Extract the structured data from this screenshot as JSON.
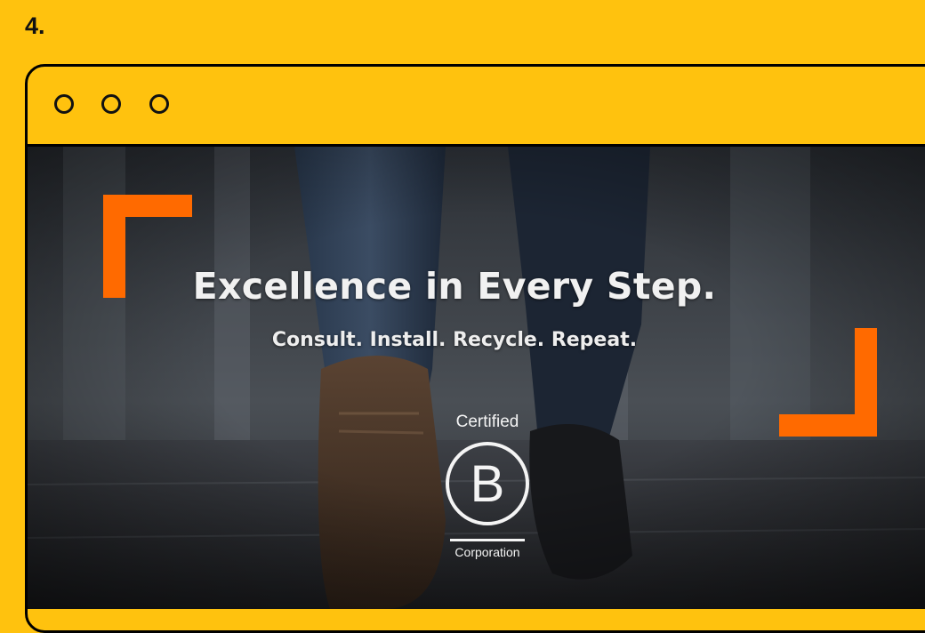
{
  "step": {
    "number": "4."
  },
  "window": {
    "controls": [
      "circle-icon",
      "circle-icon",
      "circle-icon"
    ]
  },
  "hero": {
    "title": "Excellence in Every Step.",
    "subtitle": "Consult. Install. Recycle. Repeat.",
    "badge": {
      "top_text": "Certified",
      "letter": "B",
      "bottom_text": "Corporation"
    }
  },
  "colors": {
    "page_background": "#FFC20E",
    "accent_orange": "#FF6A00",
    "frame": "#000000",
    "text_light": "#F1F1F1"
  }
}
